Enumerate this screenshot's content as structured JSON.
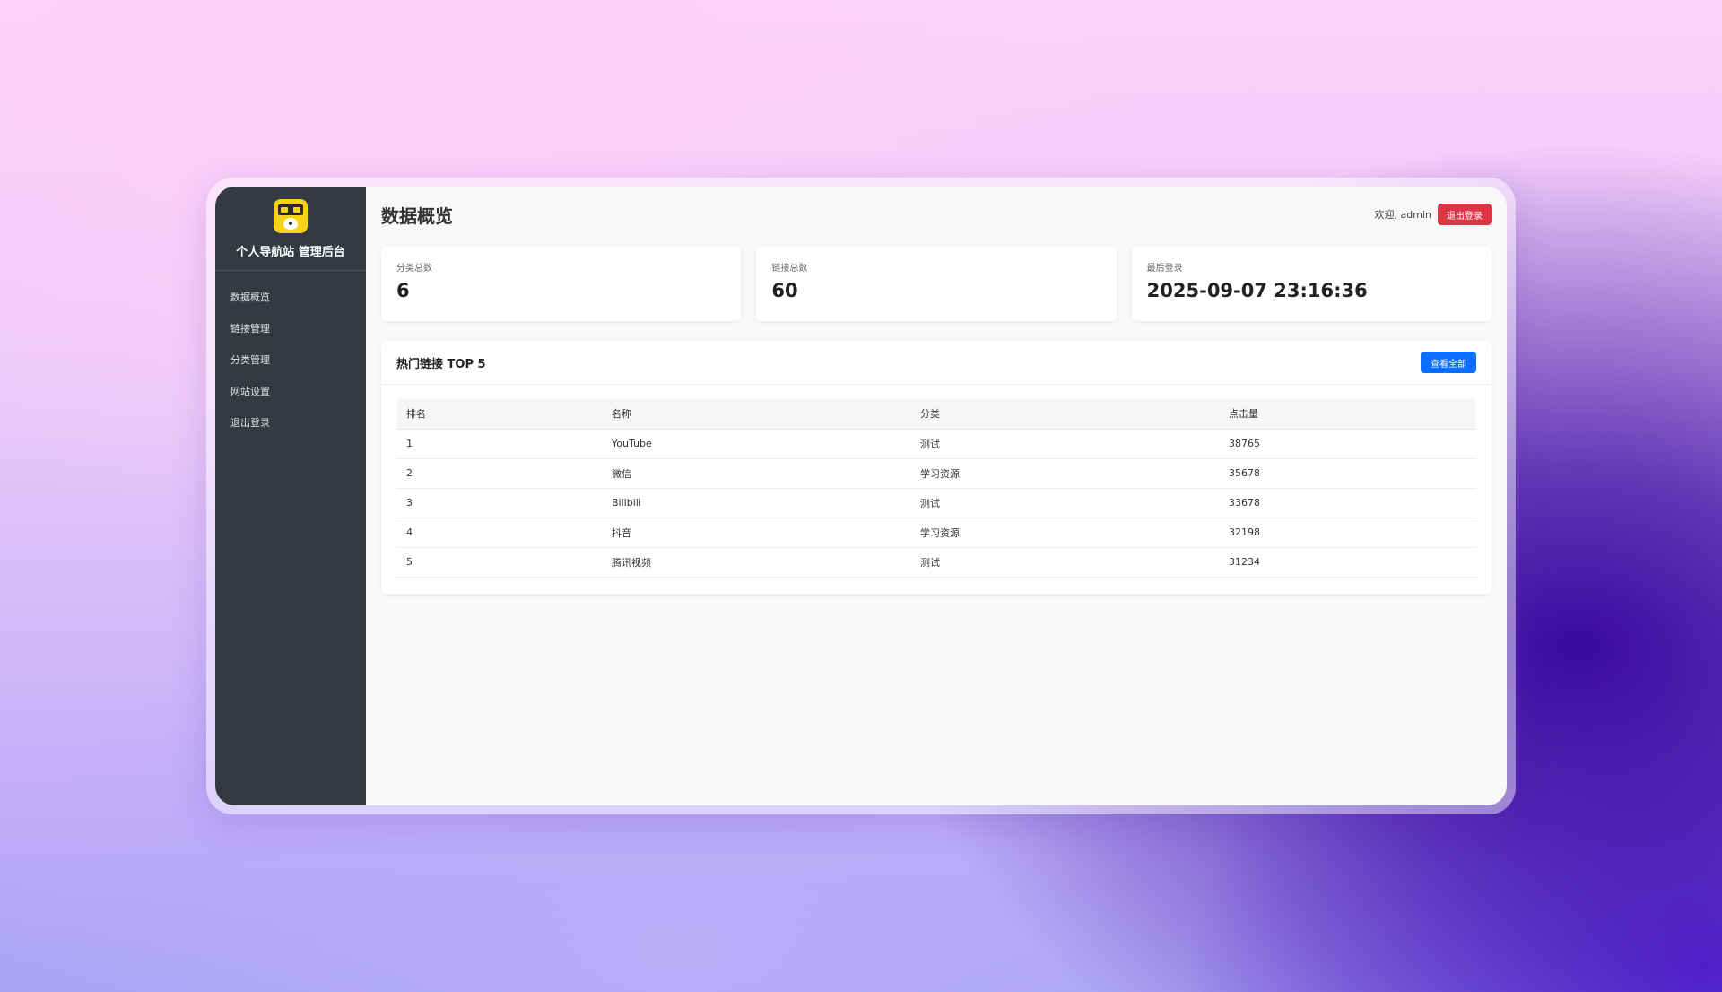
{
  "brand": {
    "title": "个人导航站 管理后台",
    "logo_icon": "dog-face-logo-icon"
  },
  "sidebar": {
    "items": [
      {
        "label": "数据概览"
      },
      {
        "label": "链接管理"
      },
      {
        "label": "分类管理"
      },
      {
        "label": "网站设置"
      },
      {
        "label": "退出登录"
      }
    ]
  },
  "header": {
    "title": "数据概览",
    "welcome": "欢迎, admin",
    "logout_label": "退出登录"
  },
  "stats": [
    {
      "label": "分类总数",
      "value": "6"
    },
    {
      "label": "链接总数",
      "value": "60"
    },
    {
      "label": "最后登录",
      "value": "2025-09-07 23:16:36"
    }
  ],
  "top_links": {
    "title": "热门链接 TOP 5",
    "view_all_label": "查看全部",
    "columns": [
      "排名",
      "名称",
      "分类",
      "点击量"
    ],
    "rows": [
      {
        "rank": "1",
        "name": "YouTube",
        "category": "测试",
        "clicks": "38765"
      },
      {
        "rank": "2",
        "name": "微信",
        "category": "学习资源",
        "clicks": "35678"
      },
      {
        "rank": "3",
        "name": "Bilibili",
        "category": "测试",
        "clicks": "33678"
      },
      {
        "rank": "4",
        "name": "抖音",
        "category": "学习资源",
        "clicks": "32198"
      },
      {
        "rank": "5",
        "name": "腾讯视频",
        "category": "测试",
        "clicks": "31234"
      }
    ]
  },
  "colors": {
    "sidebar_bg": "#343a40",
    "danger": "#dc3545",
    "primary": "#0d6efd",
    "logo_yellow": "#f7d316"
  }
}
